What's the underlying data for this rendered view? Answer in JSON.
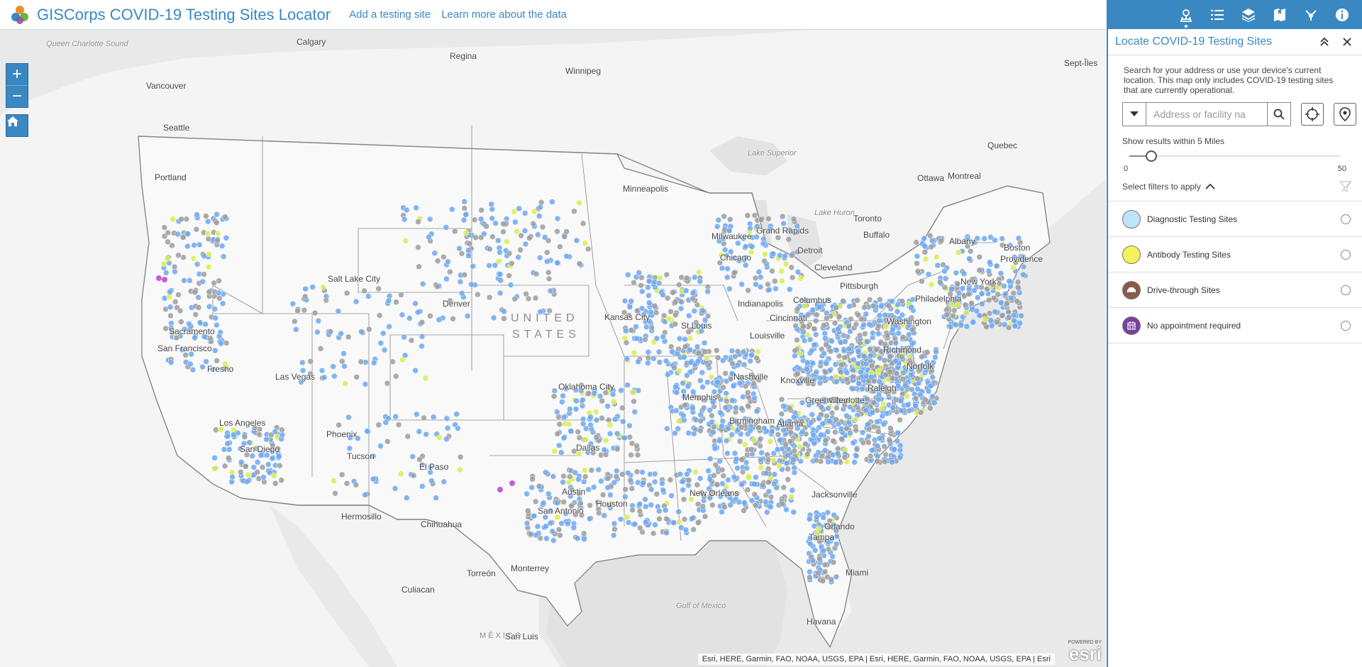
{
  "header": {
    "title": "GISCorps COVID-19 Testing Sites Locator",
    "links": [
      "Add a testing site",
      "Learn more about the data"
    ]
  },
  "toolbar": {
    "icons": [
      "locate-panel-icon",
      "list-icon",
      "layers-icon",
      "bookmark-icon",
      "share-icon",
      "info-icon"
    ]
  },
  "panel": {
    "title": "Locate COVID-19 Testing Sites",
    "instructions": "Search for your address or use your device's current location. This map only includes COVID-19 testing sites that are currently operational.",
    "search_placeholder": "Address or facility na",
    "radius_label": "Show results within 5 Miles",
    "slider_min": "0",
    "slider_max": "50",
    "slider_value": 5,
    "filters_label": "Select filters to apply",
    "filters": [
      {
        "label": "Diagnostic Testing Sites",
        "color": "#bfe3f7"
      },
      {
        "label": "Antibody Testing Sites",
        "color": "#f2f25a"
      },
      {
        "label": "Drive-through Sites",
        "color": "#8a5a4a"
      },
      {
        "label": "No appointment required",
        "color": "#7b3f9e"
      }
    ]
  },
  "map": {
    "country_labels": [
      "UNITED",
      "STATES",
      "MÉXICO"
    ],
    "water_labels": [
      "Queen Charlotte Sound",
      "Lake Superior",
      "Lake Huron",
      "Gulf of Mexico"
    ],
    "cities": [
      "Calgary",
      "Regina",
      "Winnipeg",
      "Vancouver",
      "Seattle",
      "Portland",
      "Minneapolis",
      "Toronto",
      "Ottawa",
      "Montreal",
      "Quebec",
      "Sept-Îles",
      "Boston",
      "Albany",
      "Providence",
      "New York",
      "Philadelphia",
      "Washington",
      "Richmond",
      "Norfolk",
      "Raleigh",
      "Charlotte",
      "Atlanta",
      "Jacksonville",
      "Orlando",
      "Tampa",
      "Miami",
      "Chicago",
      "Milwaukee",
      "Grand Rapids",
      "Detroit",
      "Cleveland",
      "Pittsburgh",
      "Buffalo",
      "Columbus",
      "Indianapolis",
      "Cincinnati",
      "Louisville",
      "St Louis",
      "Kansas City",
      "Nashville",
      "Knoxville",
      "Greenville",
      "Memphis",
      "Birmingham",
      "New Orleans",
      "Houston",
      "Austin",
      "San Antonio",
      "Dallas",
      "Oklahoma City",
      "Denver",
      "Salt Lake City",
      "Las Vegas",
      "Phoenix",
      "Tucson",
      "El Paso",
      "Los Angeles",
      "San Diego",
      "Fresno",
      "San Francisco",
      "Sacramento",
      "Hermosillo",
      "Chihuahua",
      "Torreón",
      "Monterrey",
      "Culiacan",
      "San Luis",
      "Havana"
    ],
    "zoom_in": "+",
    "zoom_out": "−",
    "attribution": "Esri, HERE, Garmin, FAO, NOAA, USGS, EPA | Esri, HERE, Garmin, FAO, NOAA, USGS, EPA | Esri",
    "powered_by": "POWERED BY",
    "esri_logo": "esri"
  },
  "colors": {
    "accent": "#3a88c2",
    "diagnostic_dot": "#6fa8f0",
    "other_dot": "#9e9e9e",
    "antibody_dot": "#d8ee50",
    "noappt_dot": "#c65ad8"
  }
}
